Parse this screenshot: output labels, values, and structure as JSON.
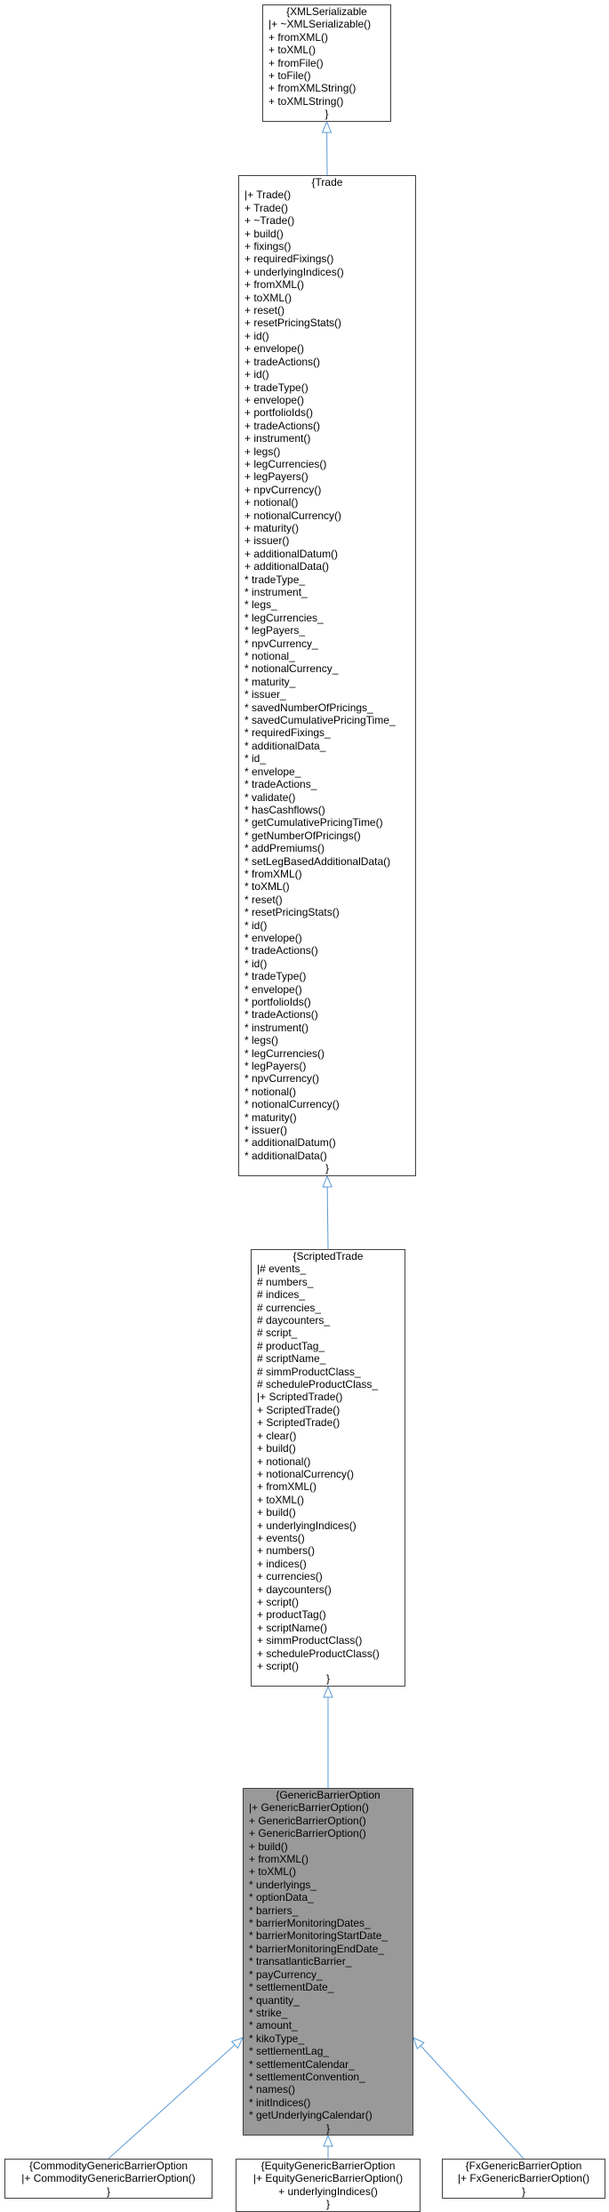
{
  "diagram": {
    "edge_color": "#5b9bd5",
    "nodes": {
      "xml_serializable": {
        "name": "XMLSerializable",
        "lines": [
          "|+ ~XMLSerializable()",
          "+ fromXML()",
          "+ toXML()",
          "+ fromFile()",
          "+ toFile()",
          "+ fromXMLString()",
          "+ toXMLString()"
        ]
      },
      "trade": {
        "name": "Trade",
        "lines": [
          "|+ Trade()",
          "+ Trade()",
          "+ ~Trade()",
          "+ build()",
          "+ fixings()",
          "+ requiredFixings()",
          "+ underlyingIndices()",
          "+ fromXML()",
          "+ toXML()",
          "+ reset()",
          "+ resetPricingStats()",
          "+ id()",
          "+ envelope()",
          "+ tradeActions()",
          "+ id()",
          "+ tradeType()",
          "+ envelope()",
          "+ portfolioIds()",
          "+ tradeActions()",
          "+ instrument()",
          "+ legs()",
          "+ legCurrencies()",
          "+ legPayers()",
          "+ npvCurrency()",
          "+ notional()",
          "+ notionalCurrency()",
          "+ maturity()",
          "+ issuer()",
          "+ additionalDatum()",
          "+ additionalData()",
          "* tradeType_",
          "* instrument_",
          "* legs_",
          "* legCurrencies_",
          "* legPayers_",
          "* npvCurrency_",
          "* notional_",
          "* notionalCurrency_",
          "* maturity_",
          "* issuer_",
          "* savedNumberOfPricings_",
          "* savedCumulativePricingTime_",
          "* requiredFixings_",
          "* additionalData_",
          "* id_",
          "* envelope_",
          "* tradeActions_",
          "* validate()",
          "* hasCashflows()",
          "* getCumulativePricingTime()",
          "* getNumberOfPricings()",
          "* addPremiums()",
          "* setLegBasedAdditionalData()",
          "* fromXML()",
          "* toXML()",
          "* reset()",
          "* resetPricingStats()",
          "* id()",
          "* envelope()",
          "* tradeActions()",
          "* id()",
          "* tradeType()",
          "* envelope()",
          "* portfolioIds()",
          "* tradeActions()",
          "* instrument()",
          "* legs()",
          "* legCurrencies()",
          "* legPayers()",
          "* npvCurrency()",
          "* notional()",
          "* notionalCurrency()",
          "* maturity()",
          "* issuer()",
          "* additionalDatum()",
          "* additionalData()"
        ]
      },
      "scripted_trade": {
        "name": "ScriptedTrade",
        "lines": [
          "|# events_",
          "# numbers_",
          "# indices_",
          "# currencies_",
          "# daycounters_",
          "# script_",
          "# productTag_",
          "# scriptName_",
          "# simmProductClass_",
          "# scheduleProductClass_",
          "|+ ScriptedTrade()",
          "+ ScriptedTrade()",
          "+ ScriptedTrade()",
          "+ clear()",
          "+ build()",
          "+ notional()",
          "+ notionalCurrency()",
          "+ fromXML()",
          "+ toXML()",
          "+ build()",
          "+ underlyingIndices()",
          "+ events()",
          "+ numbers()",
          "+ indices()",
          "+ currencies()",
          "+ daycounters()",
          "+ script()",
          "+ productTag()",
          "+ scriptName()",
          "+ simmProductClass()",
          "+ scheduleProductClass()",
          "+ script()"
        ]
      },
      "generic_barrier_option": {
        "name": "GenericBarrierOption",
        "lines": [
          "|+ GenericBarrierOption()",
          "+ GenericBarrierOption()",
          "+ GenericBarrierOption()",
          "+ build()",
          "+ fromXML()",
          "+ toXML()",
          "* underlyings_",
          "* optionData_",
          "* barriers_",
          "* barrierMonitoringDates_",
          "* barrierMonitoringStartDate_",
          "* barrierMonitoringEndDate_",
          "* transatlanticBarrier_",
          "* payCurrency_",
          "* settlementDate_",
          "* quantity_",
          "* strike_",
          "* amount_",
          "* kikoType_",
          "* settlementLag_",
          "* settlementCalendar_",
          "* settlementConvention_",
          "* names()",
          "* initIndices()",
          "* getUnderlyingCalendar()"
        ]
      },
      "commodity_generic_barrier_option": {
        "name": "CommodityGenericBarrierOption",
        "lines": [
          "|+ CommodityGenericBarrierOption()"
        ]
      },
      "equity_generic_barrier_option": {
        "name": "EquityGenericBarrierOption",
        "lines": [
          "|+ EquityGenericBarrierOption()",
          "+ underlyingIndices()"
        ]
      },
      "fx_generic_barrier_option": {
        "name": "FxGenericBarrierOption",
        "lines": [
          "|+ FxGenericBarrierOption()"
        ]
      }
    }
  }
}
